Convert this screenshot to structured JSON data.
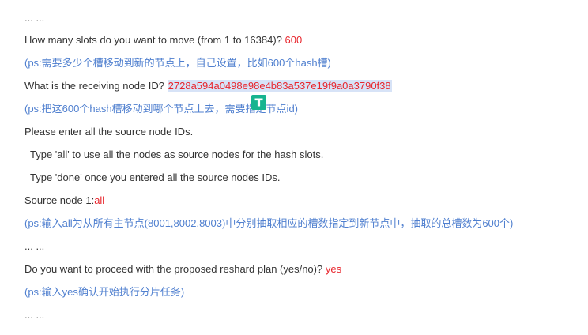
{
  "lines": {
    "l1": "... ...",
    "l2_prompt": "How many slots do you want to move (from 1 to 16384)? ",
    "l2_value": "600",
    "l3": "(ps:需要多少个槽移动到新的节点上，自己设置，比如600个hash槽)",
    "l4_prompt": "What is the receiving node ID? ",
    "l4_value": "2728a594a0498e98e4b83a537e19f9a0a3790f38",
    "l5": "(ps:把这600个hash槽移动到哪个节点上去，需要指定节点id)",
    "l6": "Please enter all the source node IDs.",
    "l7": "Type 'all' to use all the nodes as source nodes for the hash slots.",
    "l8": "Type 'done' once you entered all the source nodes IDs.",
    "l9_prompt": "Source node 1:",
    "l9_value": "all",
    "l10": "(ps:输入all为从所有主节点(8001,8002,8003)中分别抽取相应的槽数指定到新节点中，抽取的总槽数为600个)",
    "l11": " ... ...",
    "l12_prompt": "Do you want to proceed with the proposed reshard plan (yes/no)? ",
    "l12_value": "yes",
    "l13": "(ps:输入yes确认开始执行分片任务)",
    "l14": "... ..."
  },
  "colors": {
    "text": "#333333",
    "note": "#4f7fcf",
    "value": "#e8262d",
    "highlight": "#d7e3f7",
    "badge": "#17b48f"
  },
  "overlay_icon": "translate-badge-icon"
}
